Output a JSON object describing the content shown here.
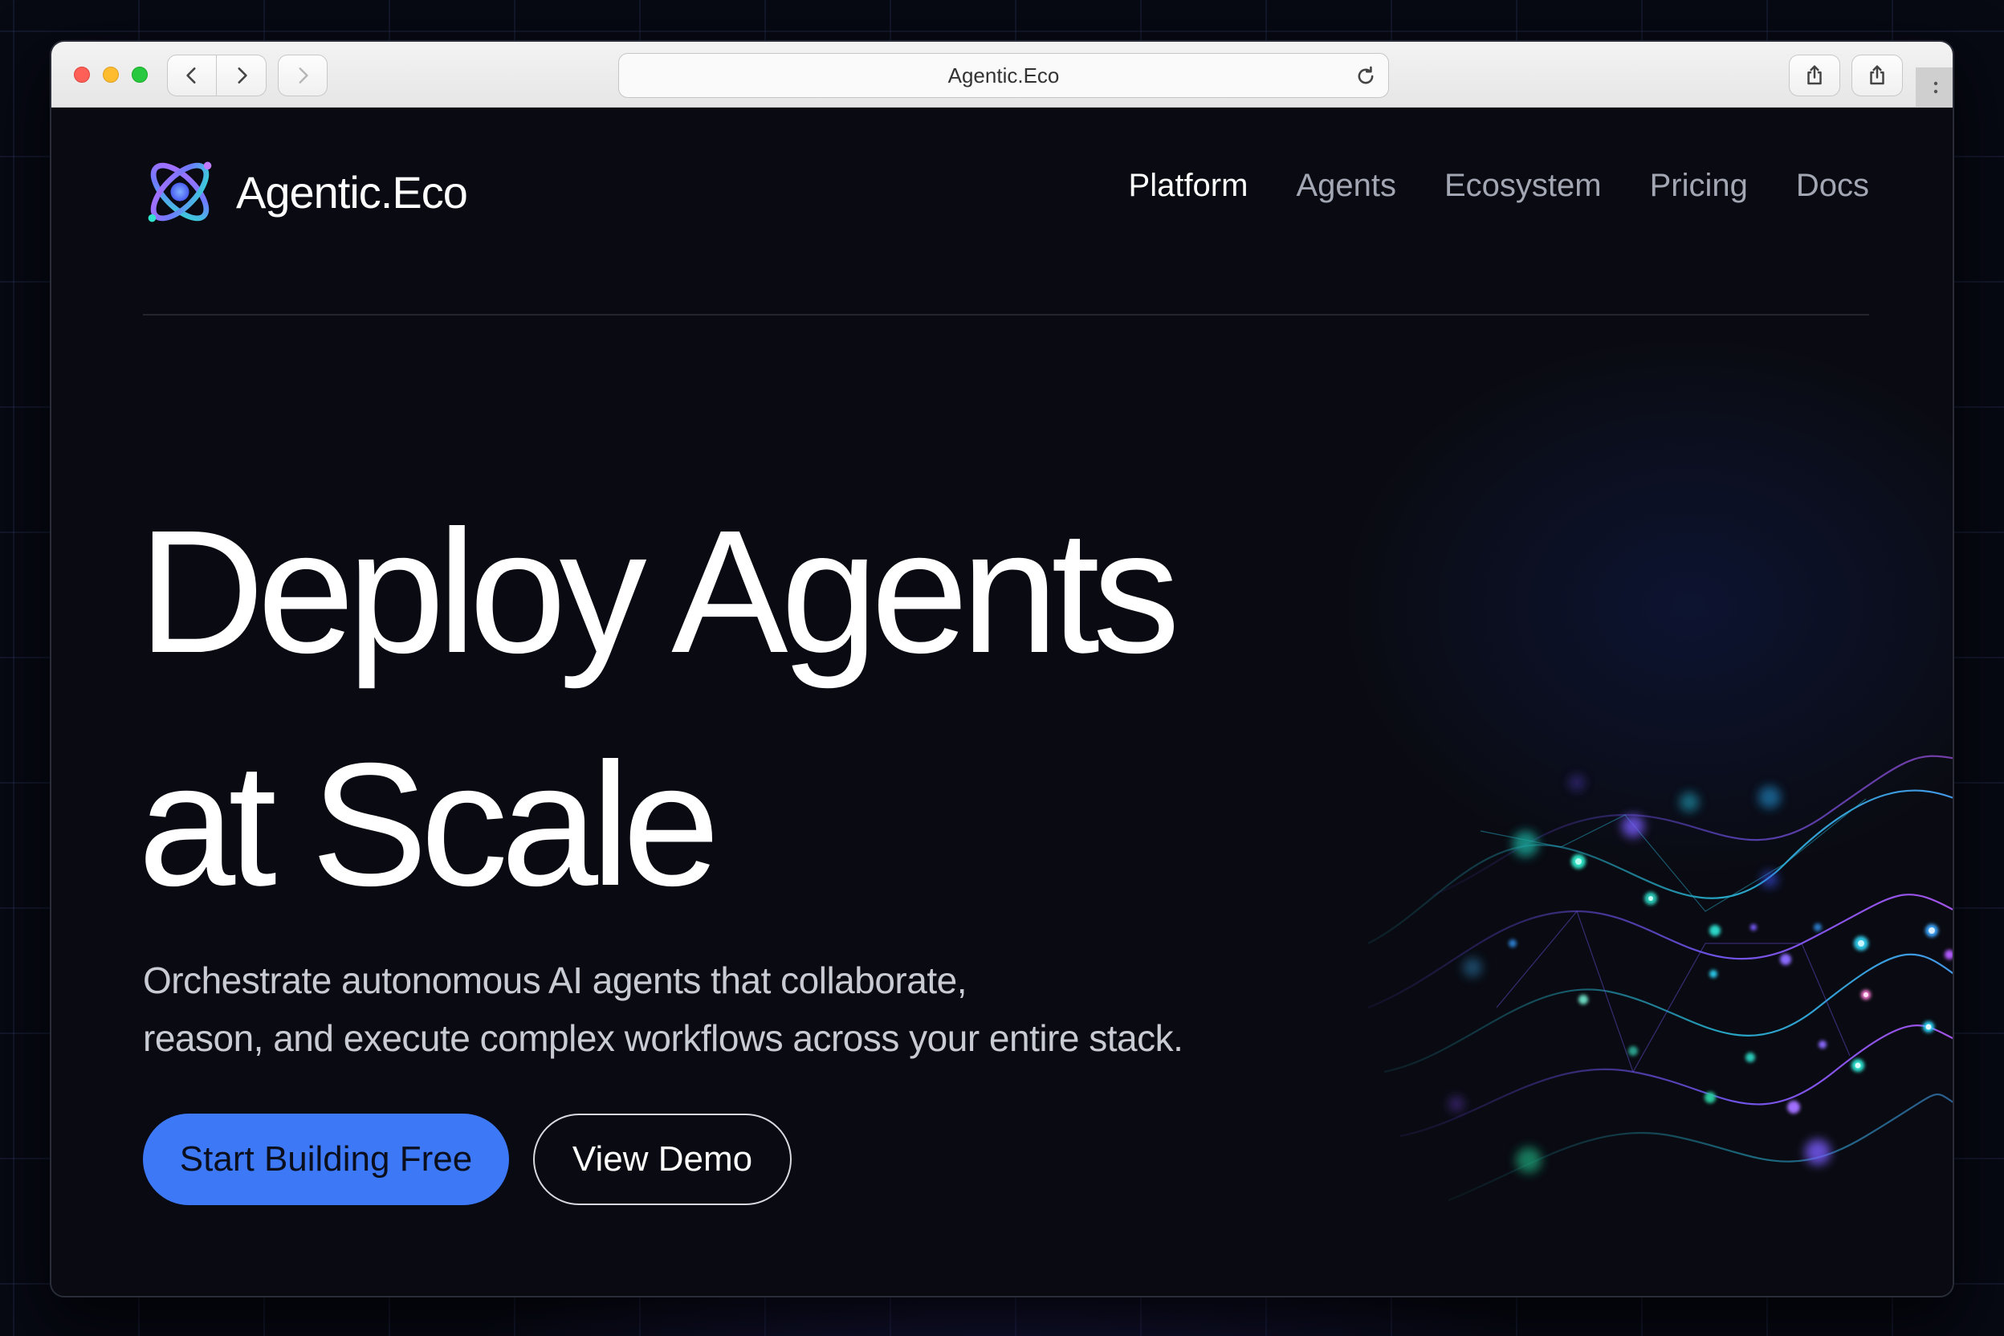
{
  "browser": {
    "url": "Agentic.Eco"
  },
  "site": {
    "brand_name": "Agentic.Eco",
    "nav": [
      {
        "label": "Platform",
        "active": true
      },
      {
        "label": "Agents",
        "active": false
      },
      {
        "label": "Ecosystem",
        "active": false
      },
      {
        "label": "Pricing",
        "active": false
      },
      {
        "label": "Docs",
        "active": false
      }
    ]
  },
  "hero": {
    "title_line1": "Deploy Agents",
    "title_line2": "at Scale",
    "subtitle_line1": "Orchestrate autonomous AI agents that collaborate,",
    "subtitle_line2": "reason, and execute complex workflows across your entire stack.",
    "primary_cta": "Start Building Free",
    "secondary_cta": "View Demo"
  },
  "colors": {
    "accent": "#3d78f7",
    "background": "#0a0b12",
    "nav_inactive": "#a3a6b3"
  },
  "icons": {
    "logo": "orbit-atom-icon",
    "back": "chevron-left-icon",
    "forward": "chevron-right-icon",
    "reload": "reload-icon",
    "share": "share-icon",
    "more": "more-vertical-icon"
  }
}
